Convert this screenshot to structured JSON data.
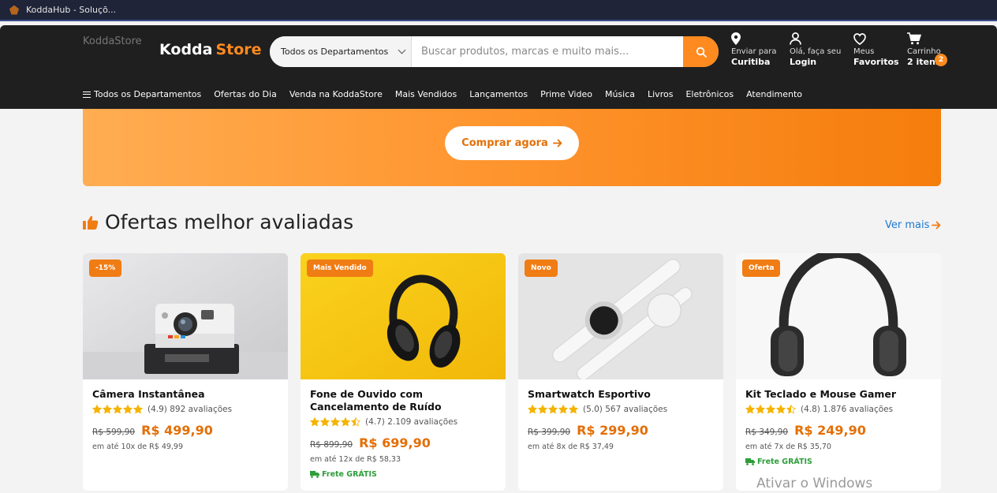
{
  "browser": {
    "tab_title": "KoddaHub - Soluçõ..."
  },
  "header": {
    "logo_alt": "KoddaStore",
    "brand_name": "Kodda",
    "brand_accent": "Store",
    "department_select": "Todos os Departamentos",
    "search_placeholder": "Buscar produtos, marcas e muito mais...",
    "location": {
      "line1": "Enviar para",
      "line2": "Curitiba"
    },
    "account": {
      "line1": "Olá, faça seu",
      "line2": "Login"
    },
    "favorites": {
      "line1": "Meus",
      "line2": "Favoritos"
    },
    "cart": {
      "line1": "Carrinho",
      "line2": "2 itens",
      "count": "2"
    }
  },
  "nav": {
    "items": [
      "Todos os Departamentos",
      "Ofertas do Dia",
      "Venda na KoddaStore",
      "Mais Vendidos",
      "Lançamentos",
      "Prime Video",
      "Música",
      "Livros",
      "Eletrônicos",
      "Atendimento"
    ]
  },
  "hero": {
    "button_label": "Comprar agora"
  },
  "section": {
    "title": "Ofertas melhor avaliadas",
    "see_more": "Ver mais"
  },
  "products": [
    {
      "badge": "-15%",
      "name": "Câmera Instantânea",
      "rating": 4.9,
      "rating_text": "(4.9) 892 avaliações",
      "old_price": "R$ 599,90",
      "price": "R$ 499,90",
      "installments": "em até 10x de R$ 49,99",
      "shipping": ""
    },
    {
      "badge": "Mais Vendido",
      "name": "Fone de Ouvido com Cancelamento de Ruído",
      "rating": 4.7,
      "rating_text": "(4.7) 2.109 avaliações",
      "old_price": "R$ 899,90",
      "price": "R$ 699,90",
      "installments": "em até 12x de R$ 58,33",
      "shipping": "Frete GRÁTIS"
    },
    {
      "badge": "Novo",
      "name": "Smartwatch Esportivo",
      "rating": 5.0,
      "rating_text": "(5.0) 567 avaliações",
      "old_price": "R$ 399,90",
      "price": "R$ 299,90",
      "installments": "em até 8x de R$ 37,49",
      "shipping": ""
    },
    {
      "badge": "Oferta",
      "name": "Kit Teclado e Mouse Gamer",
      "rating": 4.8,
      "rating_text": "(4.8) 1.876 avaliações",
      "old_price": "R$ 349,90",
      "price": "R$ 249,90",
      "installments": "em até 7x de R$ 35,70",
      "shipping": "Frete GRÁTIS"
    }
  ],
  "os_watermark": "Ativar o Windows",
  "colors": {
    "accent": "#ff8a1f",
    "header_bg": "#1f1f1f",
    "price": "#e36f07",
    "link": "#1e78d2",
    "shipping": "#2e9e3a"
  }
}
